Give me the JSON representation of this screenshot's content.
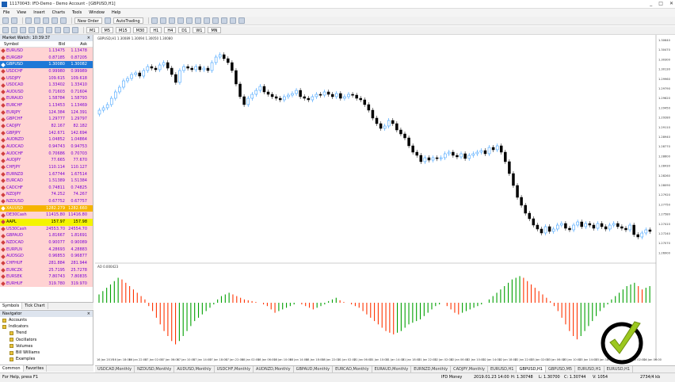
{
  "window": {
    "title": "11170043: IFD-Demo - Demo Account - [GBPUSD,H1]",
    "controls": [
      "_",
      "□",
      "✕"
    ]
  },
  "menu": [
    "File",
    "View",
    "Insert",
    "Charts",
    "Tools",
    "Window",
    "Help"
  ],
  "toolbar": {
    "new_order": "New Order",
    "autotrading": "AutoTrading",
    "periods": [
      "M1",
      "M5",
      "M15",
      "M30",
      "H1",
      "H4",
      "D1",
      "W1",
      "MN"
    ]
  },
  "market_watch": {
    "title": "Market Watch: 10:39:37",
    "col_symbol": "Symbol",
    "col_bid": "Bid",
    "col_ask": "Ask",
    "rows": [
      {
        "symbol": "EURUSD",
        "bid": "1.13475",
        "ask": "1.13478",
        "bg": "#ffd3d3",
        "fg": "#7a00d6"
      },
      {
        "symbol": "EURGBP",
        "bid": "0.87185",
        "ask": "0.87205",
        "bg": "#ffd3d3",
        "fg": "#7a00d6"
      },
      {
        "symbol": "GBPUSD",
        "bid": "1.30080",
        "ask": "1.30082",
        "bg": "#1e78d7",
        "fg": "#ffffff"
      },
      {
        "symbol": "USDCHF",
        "bid": "0.99980",
        "ask": "0.99989",
        "bg": "#ffd3d3",
        "fg": "#7a00d6"
      },
      {
        "symbol": "USDJPY",
        "bid": "109.615",
        "ask": "109.618",
        "bg": "#ffd3d3",
        "fg": "#7a00d6"
      },
      {
        "symbol": "USDCAD",
        "bid": "1.33402",
        "ask": "1.33410",
        "bg": "#ffd3d3",
        "fg": "#7a00d6"
      },
      {
        "symbol": "AUDUSD",
        "bid": "0.71603",
        "ask": "0.71604",
        "bg": "#ffd3d3",
        "fg": "#7a00d6"
      },
      {
        "symbol": "EURAUD",
        "bid": "1.58784",
        "ask": "1.58793",
        "bg": "#ffd3d3",
        "fg": "#7a00d6"
      },
      {
        "symbol": "EURCHF",
        "bid": "1.13453",
        "ask": "1.13469",
        "bg": "#ffd3d3",
        "fg": "#7a00d6"
      },
      {
        "symbol": "EURJPY",
        "bid": "124.384",
        "ask": "124.391",
        "bg": "#ffd3d3",
        "fg": "#7a00d6"
      },
      {
        "symbol": "GBPCHF",
        "bid": "1.29777",
        "ask": "1.29797",
        "bg": "#ffd3d3",
        "fg": "#7a00d6"
      },
      {
        "symbol": "CADJPY",
        "bid": "82.167",
        "ask": "82.182",
        "bg": "#ffd3d3",
        "fg": "#7a00d6"
      },
      {
        "symbol": "GBPJPY",
        "bid": "142.671",
        "ask": "142.694",
        "bg": "#ffd3d3",
        "fg": "#7a00d6"
      },
      {
        "symbol": "AUDNZD",
        "bid": "1.04852",
        "ask": "1.04864",
        "bg": "#ffd3d3",
        "fg": "#7a00d6"
      },
      {
        "symbol": "AUDCAD",
        "bid": "0.94743",
        "ask": "0.94753",
        "bg": "#ffd3d3",
        "fg": "#7a00d6"
      },
      {
        "symbol": "AUDCHF",
        "bid": "0.70686",
        "ask": "0.70703",
        "bg": "#ffd3d3",
        "fg": "#7a00d6"
      },
      {
        "symbol": "AUDJPY",
        "bid": "77.665",
        "ask": "77.670",
        "bg": "#ffd3d3",
        "fg": "#7a00d6"
      },
      {
        "symbol": "CHFJPY",
        "bid": "110.114",
        "ask": "110.127",
        "bg": "#ffd3d3",
        "fg": "#7a00d6"
      },
      {
        "symbol": "EURNZD",
        "bid": "1.67744",
        "ask": "1.67514",
        "bg": "#ffd3d3",
        "fg": "#7a00d6"
      },
      {
        "symbol": "EURCAD",
        "bid": "1.51389",
        "ask": "1.51384",
        "bg": "#ffd3d3",
        "fg": "#7a00d6"
      },
      {
        "symbol": "CADCHF",
        "bid": "0.74811",
        "ask": "0.74825",
        "bg": "#ffd3d3",
        "fg": "#7a00d6"
      },
      {
        "symbol": "NZDJPY",
        "bid": "74.252",
        "ask": "74.267",
        "bg": "#ffd3d3",
        "fg": "#7a00d6"
      },
      {
        "symbol": "NZDUSD",
        "bid": "0.67752",
        "ask": "0.67757",
        "bg": "#ffd3d3",
        "fg": "#7a00d6"
      },
      {
        "symbol": "XAUUSD",
        "bid": "1282.279",
        "ask": "1282.660",
        "bg": "#f5b400",
        "fg": "#ffffff"
      },
      {
        "symbol": "DE30Cash",
        "bid": "11415.80",
        "ask": "11416.80",
        "bg": "#ffd3d3",
        "fg": "#7a00d6"
      },
      {
        "symbol": "AAPL",
        "bid": "157.97",
        "ask": "157.98",
        "bg": "#f4f400",
        "fg": "#000000"
      },
      {
        "symbol": "US30Cash",
        "bid": "24553.70",
        "ask": "24554.70",
        "bg": "#ffd3d3",
        "fg": "#7a00d6"
      },
      {
        "symbol": "GBPAUD",
        "bid": "1.81667",
        "ask": "1.81691",
        "bg": "#ffd3d3",
        "fg": "#7a00d6"
      },
      {
        "symbol": "NZDCAD",
        "bid": "0.90077",
        "ask": "0.90089",
        "bg": "#ffd3d3",
        "fg": "#7a00d6"
      },
      {
        "symbol": "EURPLN",
        "bid": "4.28693",
        "ask": "4.28883",
        "bg": "#ffd3d3",
        "fg": "#7a00d6"
      },
      {
        "symbol": "AUDSGD",
        "bid": "0.96853",
        "ask": "0.96877",
        "bg": "#ffd3d3",
        "fg": "#7a00d6"
      },
      {
        "symbol": "CHFHUF",
        "bid": "281.884",
        "ask": "281.944",
        "bg": "#ffd3d3",
        "fg": "#7a00d6"
      },
      {
        "symbol": "EURCZK",
        "bid": "25.7195",
        "ask": "25.7278",
        "bg": "#ffd3d3",
        "fg": "#7a00d6"
      },
      {
        "symbol": "EURSEK",
        "bid": "7.80743",
        "ask": "7.80835",
        "bg": "#ffd3d3",
        "fg": "#7a00d6"
      },
      {
        "symbol": "EURHUF",
        "bid": "319.780",
        "ask": "319.970",
        "bg": "#ffd3d3",
        "fg": "#7a00d6"
      }
    ],
    "tabs": [
      "Symbols",
      "Tick Chart"
    ]
  },
  "navigator": {
    "title": "Navigator",
    "items": [
      "Accounts",
      "Indicators",
      "Trend",
      "Oscillators",
      "Volumes",
      "Bill Williams",
      "Examples"
    ],
    "tabs": [
      "Common",
      "Favorites"
    ]
  },
  "chart": {
    "header": "GBPUSD,H1 1.30089 1.30094 1.30050 1.30080",
    "indicator_header": "AO 0.000423",
    "price_labels": [
      "1.30640",
      "1.30470",
      "1.30300",
      "1.30130",
      "1.29960",
      "1.29790",
      "1.29620",
      "1.29450",
      "1.29280",
      "1.29110",
      "1.28940",
      "1.28770",
      "1.28600",
      "1.28430",
      "1.28260",
      "1.28090",
      "1.27920",
      "1.27750",
      "1.27580",
      "1.27410",
      "1.27240",
      "1.27070",
      "1.26900"
    ],
    "time_labels": [
      "16 Jan 2019",
      "16 Jan 18:00",
      "16 Jan 22:00",
      "17 Jan 02:00",
      "17 Jan 06:00",
      "17 Jan 10:00",
      "17 Jan 14:00",
      "17 Jan 18:00",
      "17 Jan 22:00",
      "18 Jan 02:00",
      "18 Jan 06:00",
      "18 Jan 10:00",
      "18 Jan 14:00",
      "18 Jan 18:00",
      "18 Jan 22:00",
      "21 Jan 02:00",
      "21 Jan 06:00",
      "21 Jan 10:00",
      "21 Jan 14:00",
      "21 Jan 18:00",
      "21 Jan 22:00",
      "22 Jan 02:00",
      "22 Jan 06:00",
      "22 Jan 10:00",
      "22 Jan 14:00",
      "22 Jan 18:00",
      "22 Jan 22:00",
      "23 Jan 02:00",
      "23 Jan 06:00",
      "23 Jan 10:00",
      "23 Jan 14:00",
      "23 Jan 18:00",
      "23 Jan 22:00",
      "24 Jan 02:00",
      "24 Jan 06:00"
    ],
    "bull_color": "#1e90ff",
    "bear_color": "#000000",
    "ao_up_color": "#00a000",
    "ao_down_color": "#ff3300"
  },
  "chart_tabs": [
    "USDCAD,Monthly",
    "NZDUSD,Monthly",
    "AUDUSD,Monthly",
    "USDCHF,Monthly",
    "AUDNZD,Monthly",
    "GBPAUD,Monthly",
    "EURCAD,Monthly",
    "EURAUD,Monthly",
    "EURNZD,Monthly",
    "CADJPY,Monthly",
    "EURUSD,H1",
    "GBPUSD,H1",
    "GBPUSD,M5",
    "EURUSD,H1",
    "EURUSD,H1"
  ],
  "active_chart_tab": 11,
  "status": {
    "help": "For Help, press F1",
    "profile": "IFD Money",
    "datetime": "2019.01.23 14:00",
    "high": "H: 1.30748",
    "low": "L: 1.30700",
    "close": "C: 1.30744",
    "volume": "V: 1054",
    "traffic": "2734/4 kb"
  }
}
